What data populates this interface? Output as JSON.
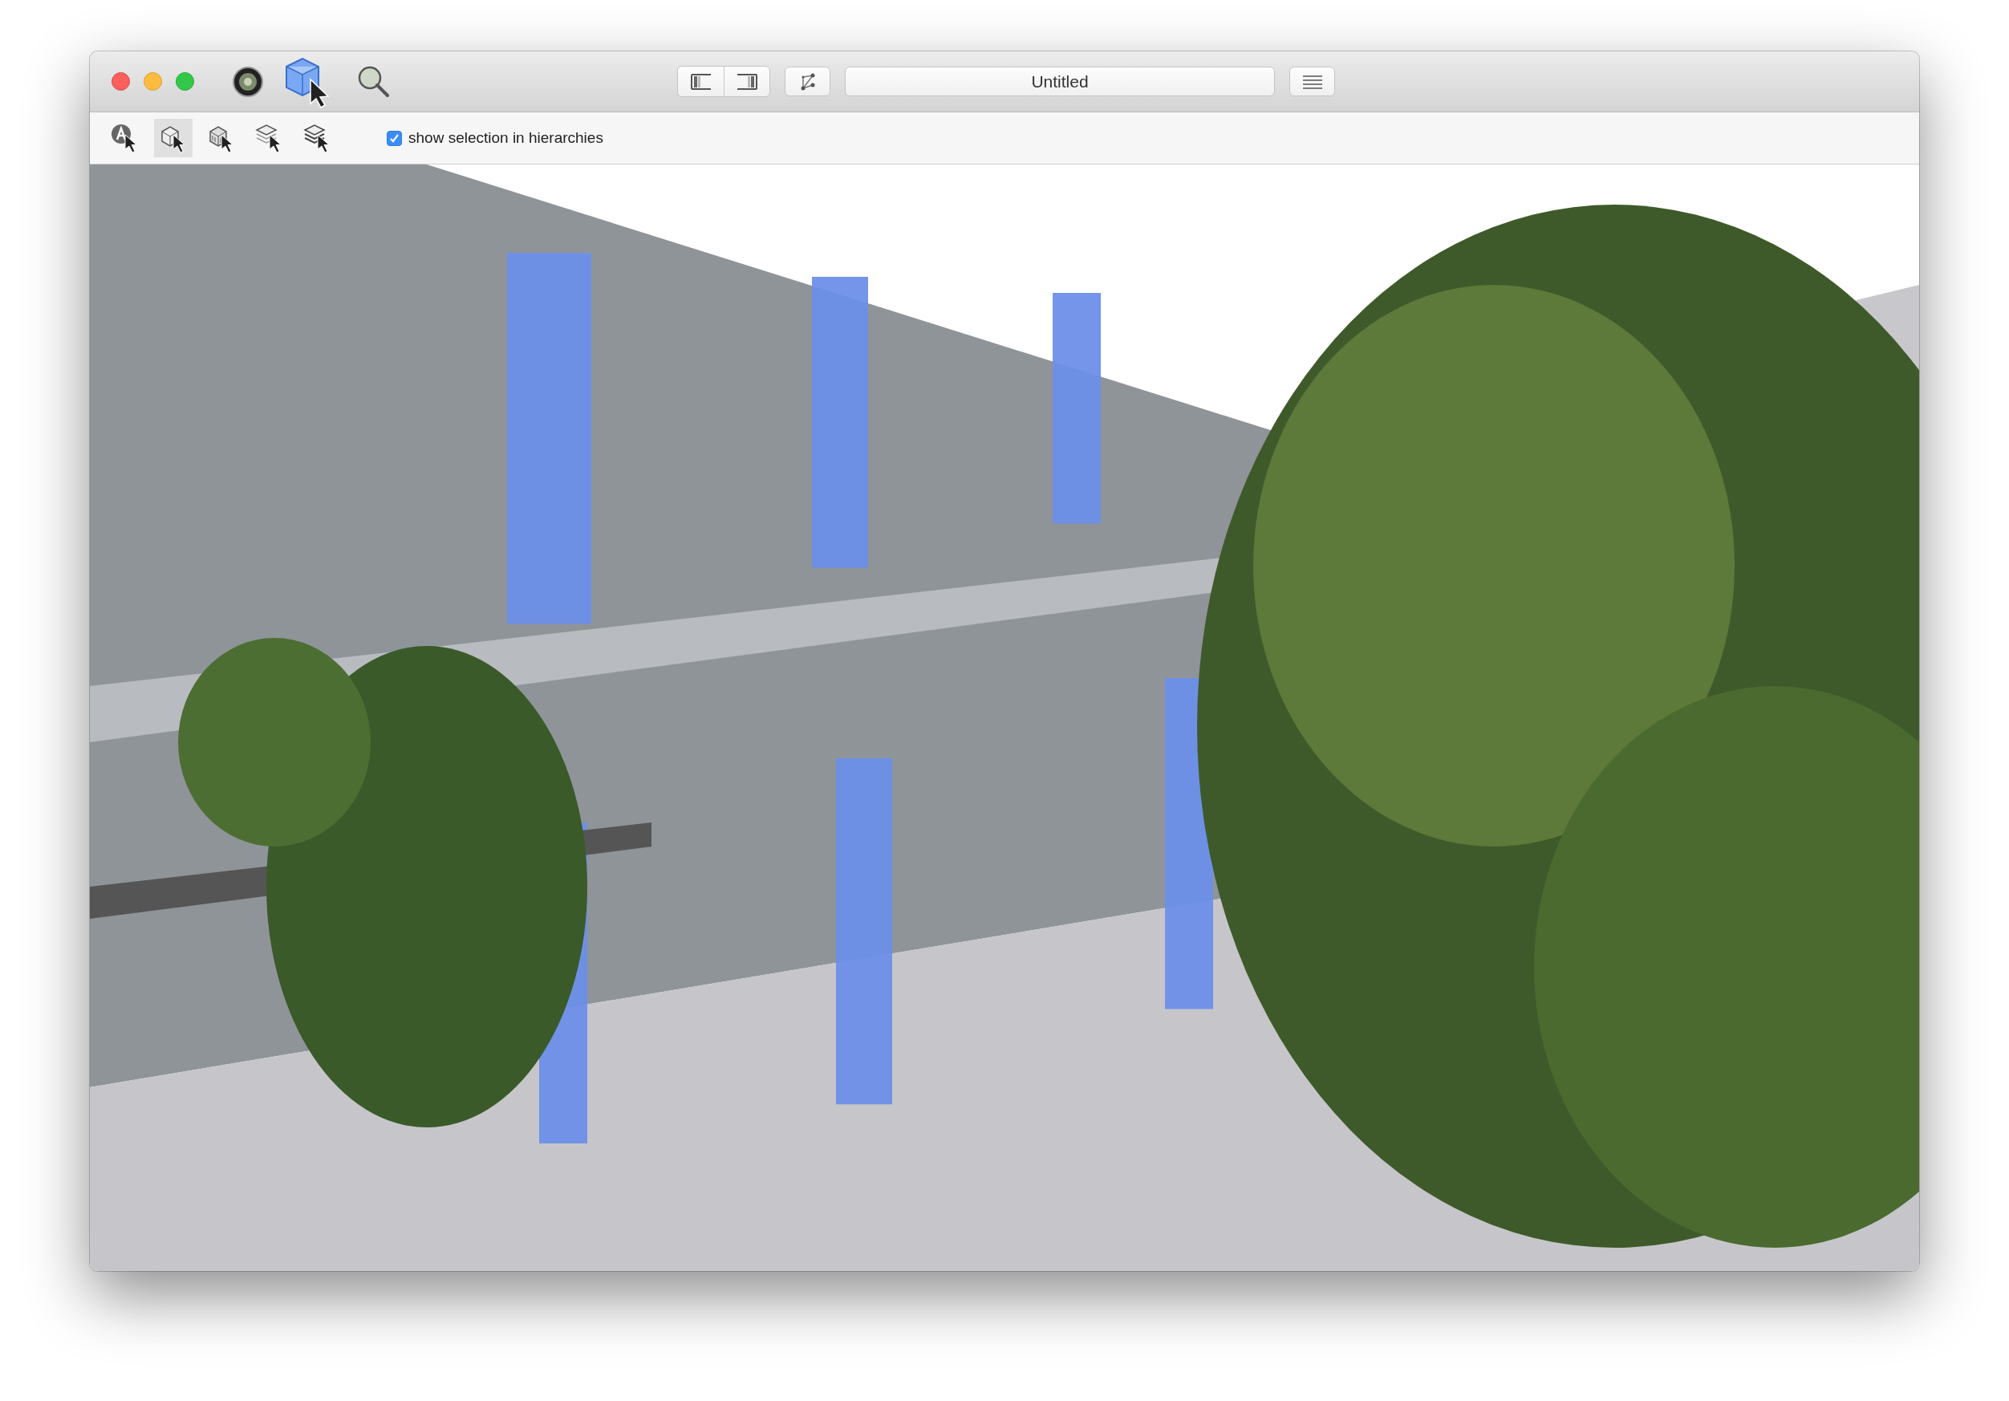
{
  "window": {
    "title": "Untitled"
  },
  "sidebar_toggles": [
    {
      "on": false
    },
    {
      "on": false
    }
  ],
  "selection_modes": [
    {
      "selected": false
    },
    {
      "selected": true
    },
    {
      "selected": false
    },
    {
      "selected": false
    },
    {
      "selected": false
    }
  ],
  "show_selection_in_hierarchies": {
    "label": "show selection in hierarchies",
    "checked": true
  }
}
